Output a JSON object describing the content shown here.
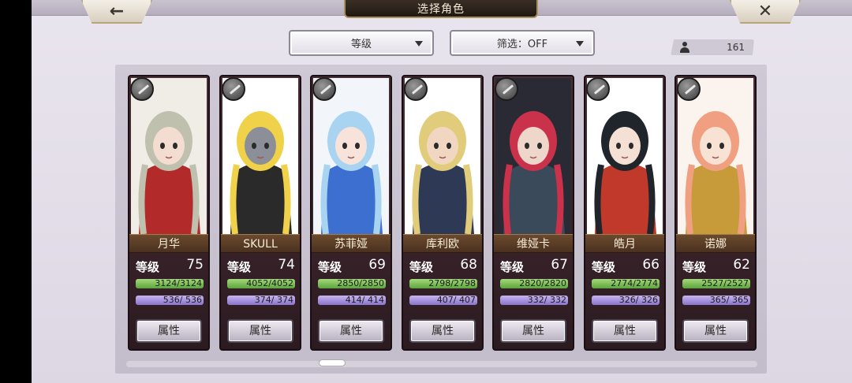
{
  "header": {
    "title": "选择角色",
    "back_icon": "←",
    "close_icon": "✕"
  },
  "sort": {
    "value": "等级"
  },
  "filter": {
    "value": "筛选：OFF"
  },
  "roster_count": "161",
  "attr_label": "属性",
  "level_label": "等级",
  "characters": [
    {
      "name": "月华",
      "level": "75",
      "hp": "3124/3124",
      "mp": "536/ 536",
      "colors": {
        "hair": "#bfc0ad",
        "bg": "#f0ece6",
        "accent": "#b32a2a",
        "skin": "#f2ddd0"
      }
    },
    {
      "name": "SKULL",
      "level": "74",
      "hp": "4052/4052",
      "mp": "374/ 374",
      "colors": {
        "hair": "#f0d24a",
        "bg": "#ffffff",
        "accent": "#2a2a2a",
        "skin": "#8c8f97"
      }
    },
    {
      "name": "苏菲娅",
      "level": "69",
      "hp": "2850/2850",
      "mp": "414/ 414",
      "colors": {
        "hair": "#a8d4f2",
        "bg": "#f2f6fb",
        "accent": "#3c6fd0",
        "skin": "#f7e3da"
      }
    },
    {
      "name": "库利欧",
      "level": "68",
      "hp": "2798/2798",
      "mp": "407/ 407",
      "colors": {
        "hair": "#e0cc7a",
        "bg": "#ffffff",
        "accent": "#2e3a55",
        "skin": "#f1d7c2"
      }
    },
    {
      "name": "维娅卡",
      "level": "67",
      "hp": "2820/2820",
      "mp": "332/ 332",
      "colors": {
        "hair": "#c9324a",
        "bg": "#2a2a35",
        "accent": "#3a4a5a",
        "skin": "#efd6ca"
      }
    },
    {
      "name": "皓月",
      "level": "66",
      "hp": "2774/2774",
      "mp": "326/ 326",
      "colors": {
        "hair": "#20252c",
        "bg": "#ffffff",
        "accent": "#c0392b",
        "skin": "#f4e0d5"
      }
    },
    {
      "name": "诺娜",
      "level": "62",
      "hp": "2527/2527",
      "mp": "365/ 365",
      "colors": {
        "hair": "#f0a080",
        "bg": "#fbf4ee",
        "accent": "#c79a3a",
        "skin": "#f7e2d4"
      }
    }
  ]
}
